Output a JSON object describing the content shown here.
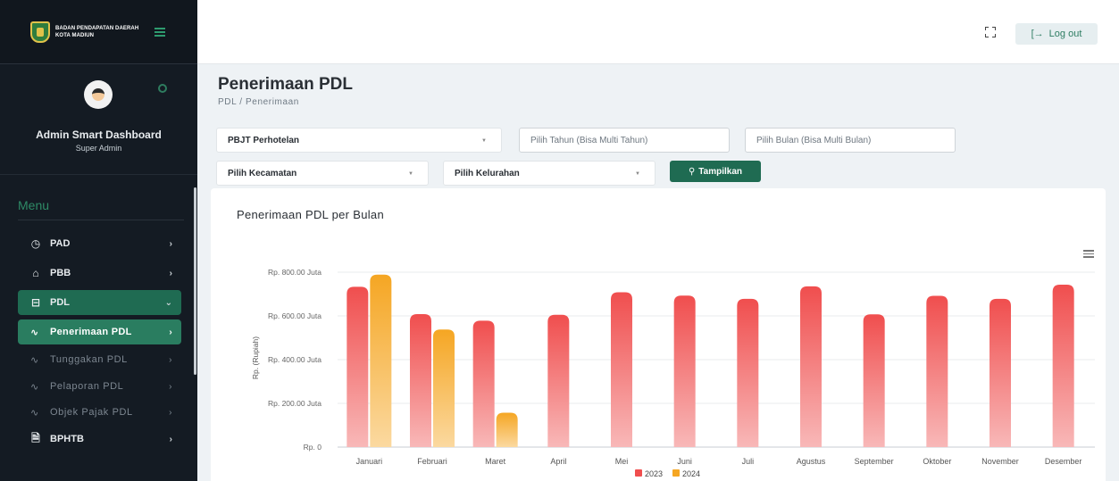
{
  "brand": {
    "line1": "BADAN PENDAPATAN DAERAH",
    "line2": "KOTA MADIUN"
  },
  "profile": {
    "name": "Admin Smart Dashboard",
    "role": "Super Admin"
  },
  "menu": {
    "title": "Menu",
    "items": [
      {
        "label": "PAD",
        "icon": "clock-icon"
      },
      {
        "label": "PBB",
        "icon": "home-icon"
      },
      {
        "label": "PDL",
        "icon": "storefront-icon"
      },
      {
        "label": "BPHTB",
        "icon": "document-icon"
      }
    ],
    "sub_items": [
      {
        "label": "Penerimaan PDL",
        "icon": "pulse-icon"
      },
      {
        "label": "Tunggakan PDL",
        "icon": "pulse-icon"
      },
      {
        "label": "Pelaporan PDL",
        "icon": "pulse-icon"
      },
      {
        "label": "Objek Pajak PDL",
        "icon": "pulse-icon"
      }
    ]
  },
  "topbar": {
    "logout_label": "Log out"
  },
  "page": {
    "title": "Penerimaan PDL",
    "breadcrumb": "PDL / Penerimaan"
  },
  "filters": {
    "jenis_pajak": "PBJT Perhotelan",
    "tahun_placeholder": "Pilih Tahun (Bisa Multi Tahun)",
    "bulan_placeholder": "Pilih Bulan (Bisa Multi Bulan)",
    "kecamatan": "Pilih Kecamatan",
    "kelurahan": "Pilih Kelurahan",
    "show_label": "Tampilkan"
  },
  "chart_data": {
    "type": "bar",
    "title": "Penerimaan PDL per Bulan",
    "ylabel": "Rp. (Rupiah)",
    "xlabel": "",
    "ylim": [
      0,
      800
    ],
    "yticks": [
      "Rp. 0",
      "Rp. 200.00 Juta",
      "Rp. 400.00 Juta",
      "Rp. 600.00 Juta",
      "Rp. 800.00 Juta"
    ],
    "categories": [
      "Januari",
      "Februari",
      "Maret",
      "April",
      "Mei",
      "Juni",
      "Juli",
      "Agustus",
      "September",
      "Oktober",
      "November",
      "Desember"
    ],
    "series": [
      {
        "name": "2023",
        "color": "#f04e4e",
        "values": [
          733,
          608,
          578,
          605,
          708,
          693,
          678,
          735,
          607,
          692,
          678,
          743
        ]
      },
      {
        "name": "2024",
        "color": "#f5a623",
        "values": [
          789,
          538,
          157,
          null,
          null,
          null,
          null,
          null,
          null,
          null,
          null,
          null
        ]
      }
    ],
    "legend_position": "bottom-center",
    "grid": true
  }
}
